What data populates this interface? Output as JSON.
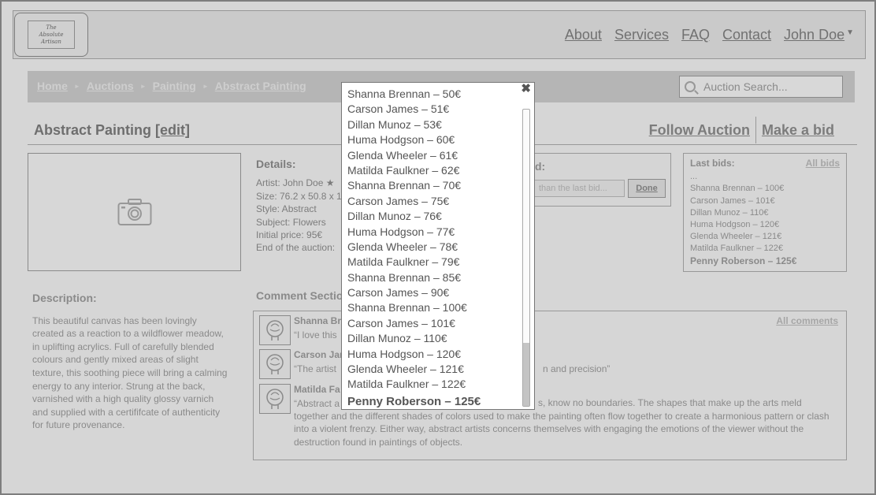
{
  "header": {
    "logo_text": "The Absolute Artisan",
    "nav": [
      "About",
      "Services",
      "FAQ",
      "Contact"
    ],
    "user": "John Doe"
  },
  "breadcrumb": {
    "items": [
      "Home",
      "Auctions",
      "Painting",
      "Abstract Painting"
    ]
  },
  "search": {
    "placeholder": "Auction Search..."
  },
  "page": {
    "title": "Abstract Painting",
    "edit_label": "[edit]",
    "follow_label": "Follow Auction",
    "bid_label": "Make a bid"
  },
  "details": {
    "heading": "Details:",
    "artist": "Artist: John Doe",
    "size": "Size: 76.2 x 50.8 x 1",
    "style": "Style: Abstract",
    "subject": "Subject: Flowers",
    "initial_price": "Initial price: 95€",
    "end": "End of the auction:"
  },
  "bid_panel": {
    "heading": "d:",
    "input_placeholder": "than the last bid...",
    "done_label": "Done"
  },
  "last_bids": {
    "heading": "Last bids:",
    "all_link": "All bids",
    "ellipsis": "...",
    "items": [
      "Shanna Brennan – 100€",
      "Carson James – 101€",
      "Dillan Munoz – 110€",
      "Huma Hodgson – 120€",
      "Glenda Wheeler – 121€",
      "Matilda Faulkner –  122€"
    ],
    "final": "Penny Roberson – 125€"
  },
  "description": {
    "heading": "Description:",
    "text": "This beautiful canvas has been lovingly created as a reaction to a wildflower meadow, in uplifting acrylics. Full of carefully blended colours and gently mixed areas of slight texture, this soothing piece will bring a calming energy to any interior. Strung at the back, varnished with a high quality glossy varnich and supplied with a certififcate of authenticity for future provenance."
  },
  "comments": {
    "heading": "Comment Sectio",
    "all_link": "All comments",
    "items": [
      {
        "author": "Shanna Bre",
        "text": "“I love this"
      },
      {
        "author": "Carson Jam",
        "text": "“The artist",
        "tail": "n and precision”"
      },
      {
        "author": "Matilda Fa",
        "text": "“Abstract a",
        "tail": "s, know no boundaries. The shapes that make up the arts meld together and the different shades of colors used to make the painting often flow together to create a harmonious pattern or clash into a violent frenzy. Either way, abstract artists concerns themselves with engaging the emotions of the viewer without the destruction found in paintings of objects."
      }
    ]
  },
  "modal": {
    "close_label": "✖",
    "bids": [
      "Shanna Brennan – 50€",
      "Carson James – 51€",
      "Dillan Munoz – 53€",
      "Huma Hodgson – 60€",
      "Glenda Wheeler – 61€",
      "Matilda Faulkner –  62€",
      "Shanna Brennan – 70€",
      "Carson James – 75€",
      "Dillan Munoz – 76€",
      "Huma Hodgson – 77€",
      "Glenda Wheeler – 78€",
      "Matilda Faulkner –  79€",
      "Shanna Brennan – 85€",
      "Carson James – 90€",
      "Shanna Brennan – 100€",
      "Carson James – 101€",
      "Dillan Munoz – 110€",
      "Huma Hodgson – 120€",
      "Glenda Wheeler – 121€",
      "Matilda Faulkner –  122€"
    ],
    "final_bid": "Penny Roberson – 125€"
  }
}
